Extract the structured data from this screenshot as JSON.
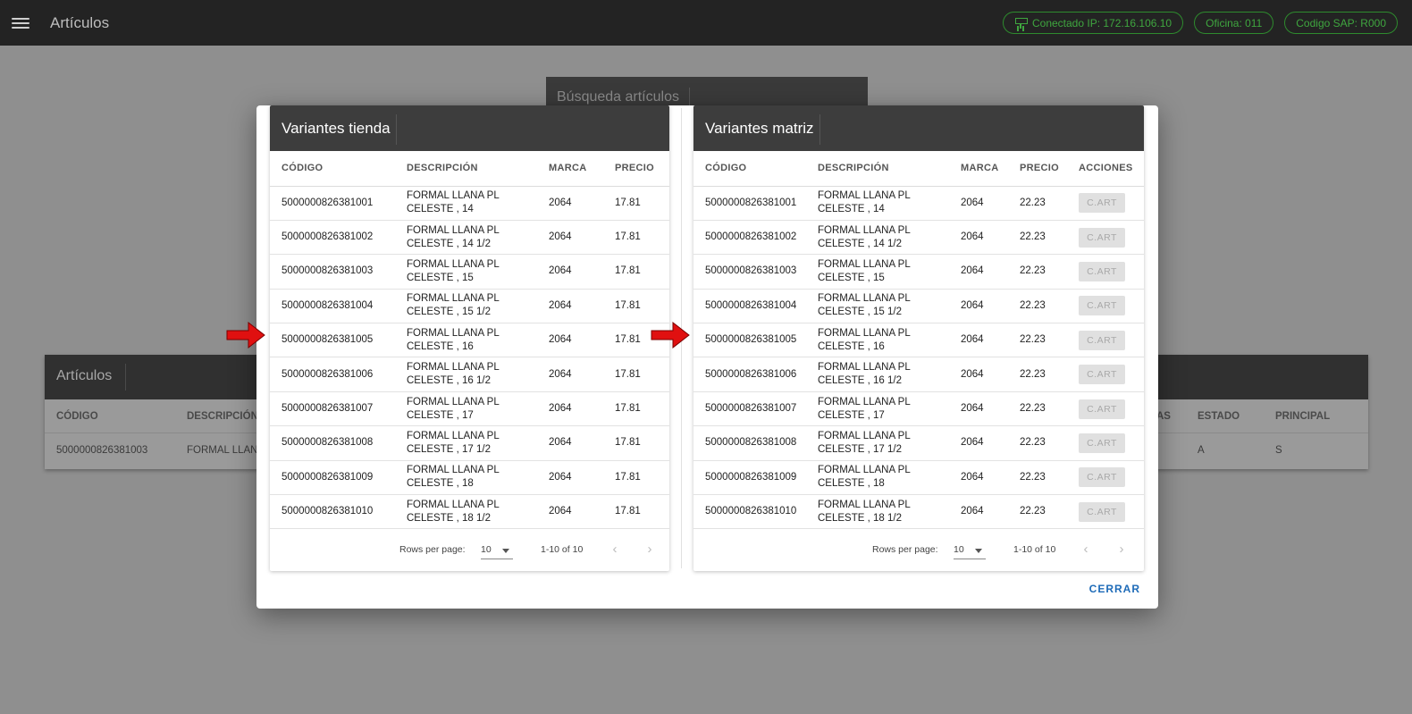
{
  "appbar": {
    "title": "Artículos",
    "chips": [
      "Conectado IP: 172.16.106.10",
      "Oficina: 011",
      "Codigo SAP: R000"
    ]
  },
  "background": {
    "search_title": "Búsqueda artículos",
    "articles": {
      "title": "Artículos",
      "columns": {
        "codigo": "CÓDIGO",
        "descripcion": "DESCRIPCIÓN",
        "as": "AS",
        "estado": "ESTADO",
        "principal": "PRINCIPAL"
      },
      "row": {
        "codigo": "5000000826381003",
        "descripcion": "FORMAL LLANA",
        "estado": "A",
        "principal": "S"
      }
    }
  },
  "tienda": {
    "title": "Variantes tienda",
    "columns": [
      "CÓDIGO",
      "DESCRIPCIÓN",
      "MARCA",
      "PRECIO"
    ],
    "rows": [
      {
        "codigo": "5000000826381001",
        "desc1": "FORMAL LLANA PL",
        "desc2": "CELESTE , 14",
        "marca": "2064",
        "precio": "17.81"
      },
      {
        "codigo": "5000000826381002",
        "desc1": "FORMAL LLANA PL",
        "desc2": "CELESTE , 14 1/2",
        "marca": "2064",
        "precio": "17.81"
      },
      {
        "codigo": "5000000826381003",
        "desc1": "FORMAL LLANA PL",
        "desc2": "CELESTE , 15",
        "marca": "2064",
        "precio": "17.81"
      },
      {
        "codigo": "5000000826381004",
        "desc1": "FORMAL LLANA PL",
        "desc2": "CELESTE , 15 1/2",
        "marca": "2064",
        "precio": "17.81"
      },
      {
        "codigo": "5000000826381005",
        "desc1": "FORMAL LLANA PL",
        "desc2": "CELESTE , 16",
        "marca": "2064",
        "precio": "17.81"
      },
      {
        "codigo": "5000000826381006",
        "desc1": "FORMAL LLANA PL",
        "desc2": "CELESTE , 16 1/2",
        "marca": "2064",
        "precio": "17.81"
      },
      {
        "codigo": "5000000826381007",
        "desc1": "FORMAL LLANA PL",
        "desc2": "CELESTE , 17",
        "marca": "2064",
        "precio": "17.81"
      },
      {
        "codigo": "5000000826381008",
        "desc1": "FORMAL LLANA PL",
        "desc2": "CELESTE , 17 1/2",
        "marca": "2064",
        "precio": "17.81"
      },
      {
        "codigo": "5000000826381009",
        "desc1": "FORMAL LLANA PL",
        "desc2": "CELESTE , 18",
        "marca": "2064",
        "precio": "17.81"
      },
      {
        "codigo": "5000000826381010",
        "desc1": "FORMAL LLANA PL",
        "desc2": "CELESTE , 18 1/2",
        "marca": "2064",
        "precio": "17.81"
      }
    ],
    "footer": {
      "rows_per_page_label": "Rows per page:",
      "rows_per_page": "10",
      "range": "1-10 of 10"
    }
  },
  "matriz": {
    "title": "Variantes matriz",
    "columns": [
      "CÓDIGO",
      "DESCRIPCIÓN",
      "MARCA",
      "PRECIO",
      "ACCIONES"
    ],
    "action_label": "C.ART",
    "rows": [
      {
        "codigo": "5000000826381001",
        "desc1": "FORMAL LLANA PL",
        "desc2": "CELESTE , 14",
        "marca": "2064",
        "precio": "22.23"
      },
      {
        "codigo": "5000000826381002",
        "desc1": "FORMAL LLANA PL",
        "desc2": "CELESTE , 14 1/2",
        "marca": "2064",
        "precio": "22.23"
      },
      {
        "codigo": "5000000826381003",
        "desc1": "FORMAL LLANA PL",
        "desc2": "CELESTE , 15",
        "marca": "2064",
        "precio": "22.23"
      },
      {
        "codigo": "5000000826381004",
        "desc1": "FORMAL LLANA PL",
        "desc2": "CELESTE , 15 1/2",
        "marca": "2064",
        "precio": "22.23"
      },
      {
        "codigo": "5000000826381005",
        "desc1": "FORMAL LLANA PL",
        "desc2": "CELESTE , 16",
        "marca": "2064",
        "precio": "22.23"
      },
      {
        "codigo": "5000000826381006",
        "desc1": "FORMAL LLANA PL",
        "desc2": "CELESTE , 16 1/2",
        "marca": "2064",
        "precio": "22.23"
      },
      {
        "codigo": "5000000826381007",
        "desc1": "FORMAL LLANA PL",
        "desc2": "CELESTE , 17",
        "marca": "2064",
        "precio": "22.23"
      },
      {
        "codigo": "5000000826381008",
        "desc1": "FORMAL LLANA PL",
        "desc2": "CELESTE , 17 1/2",
        "marca": "2064",
        "precio": "22.23"
      },
      {
        "codigo": "5000000826381009",
        "desc1": "FORMAL LLANA PL",
        "desc2": "CELESTE , 18",
        "marca": "2064",
        "precio": "22.23"
      },
      {
        "codigo": "5000000826381010",
        "desc1": "FORMAL LLANA PL",
        "desc2": "CELESTE , 18 1/2",
        "marca": "2064",
        "precio": "22.23"
      }
    ],
    "footer": {
      "rows_per_page_label": "Rows per page:",
      "rows_per_page": "10",
      "range": "1-10 of 10"
    }
  },
  "dialog": {
    "close_label": "CERRAR"
  },
  "icons": {
    "menu": "menu-icon",
    "network": "network-icon",
    "arrow": "red-arrow-icon",
    "prev": "chevron-left-icon",
    "next": "chevron-right-icon",
    "dropdown": "caret-down-icon"
  },
  "colors": {
    "appbar": "#232323",
    "chip": "#3fa63f",
    "panel_header": "#3d3d3d",
    "link": "#1e6bb8",
    "arrow": "#e01010"
  }
}
